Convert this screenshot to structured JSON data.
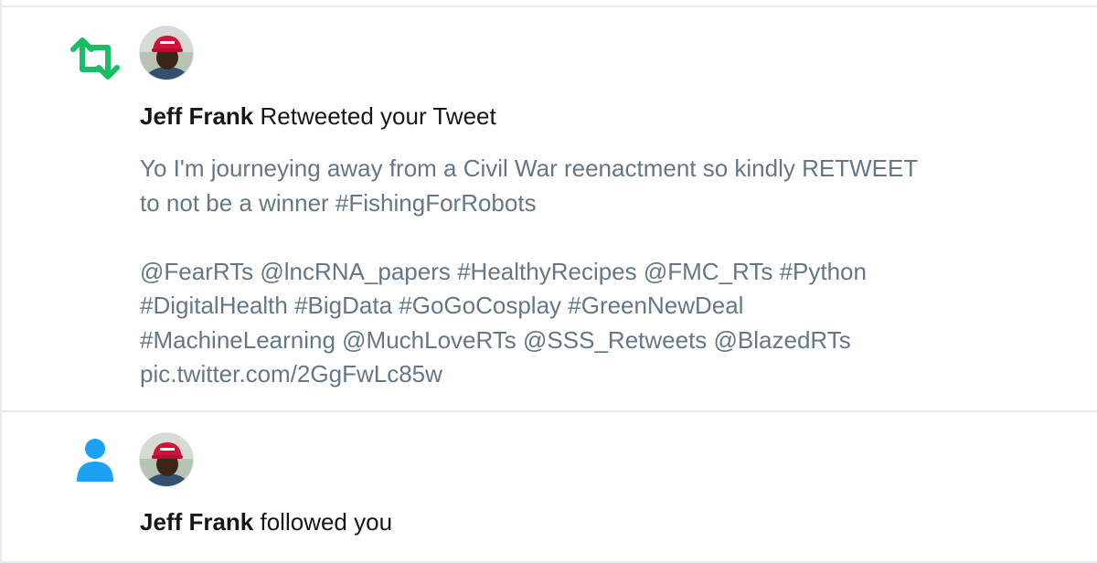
{
  "notifications": [
    {
      "type": "retweet",
      "icon": "retweet-icon",
      "icon_color": "#17bf63",
      "user_name": "Jeff Frank",
      "action_text": "Retweeted your Tweet",
      "tweet_lines_1": [
        "Yo I'm journeying away from a Civil War reenactment so kindly RETWEET",
        "to not be a winner #FishingForRobots"
      ],
      "tweet_lines_2": [
        " @FearRTs @lncRNA_papers #HealthyRecipes @FMC_RTs #Python",
        "#DigitalHealth #BigData #GoGoCosplay #GreenNewDeal",
        "#MachineLearning @MuchLoveRTs @SSS_Retweets @BlazedRTs",
        "pic.twitter.com/2GgFwLc85w"
      ]
    },
    {
      "type": "follow",
      "icon": "person-icon",
      "icon_color": "#1da1f2",
      "user_name": "Jeff Frank",
      "action_text": "followed you"
    }
  ],
  "colors": {
    "divider": "#e6ecf0",
    "name_text": "#14171a",
    "tweet_text": "#657786"
  }
}
